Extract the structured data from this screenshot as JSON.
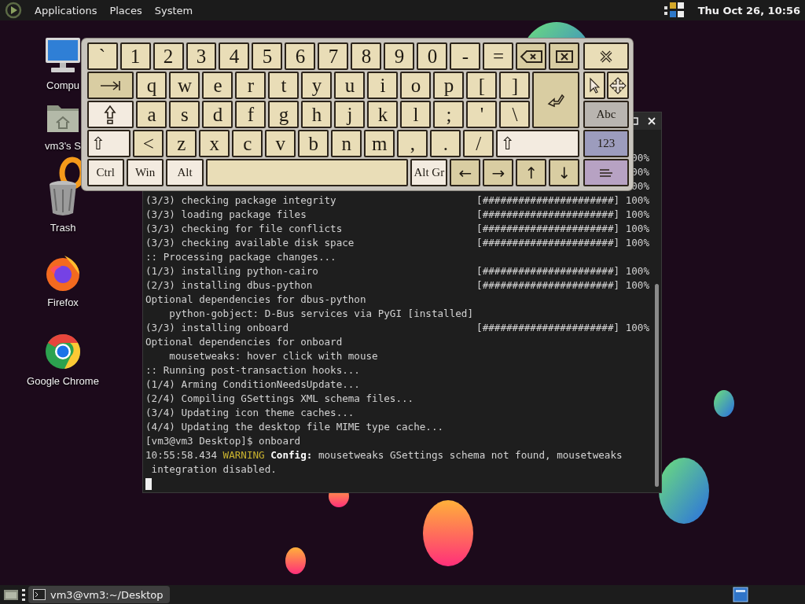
{
  "top_panel": {
    "menus": [
      "Applications",
      "Places",
      "System"
    ],
    "clock": "Thu Oct 26, 10:56"
  },
  "desktop_icons": [
    {
      "kind": "computer",
      "label": "Compu"
    },
    {
      "kind": "home-folder",
      "label": "vm3's S"
    },
    {
      "kind": "trash",
      "label": "Trash"
    },
    {
      "kind": "firefox",
      "label": "Firefox"
    },
    {
      "kind": "chrome",
      "label": "Google Chrome"
    }
  ],
  "terminal": {
    "lines": [
      {
        "pct": "00%"
      },
      {
        "pct": "00%"
      },
      {
        "pct": "00%"
      },
      {
        "text": "(3/3) checking package integrity",
        "bar": "[######################]",
        "pct": "100%"
      },
      {
        "text": "(3/3) loading package files",
        "bar": "[######################]",
        "pct": "100%"
      },
      {
        "text": "(3/3) checking for file conflicts",
        "bar": "[######################]",
        "pct": "100%"
      },
      {
        "text": "(3/3) checking available disk space",
        "bar": "[######################]",
        "pct": "100%"
      },
      {
        "text": ":: Processing package changes..."
      },
      {
        "text": "(1/3) installing python-cairo",
        "bar": "[######################]",
        "pct": "100%"
      },
      {
        "text": "(2/3) installing dbus-python",
        "bar": "[######################]",
        "pct": "100%"
      },
      {
        "text": "Optional dependencies for dbus-python"
      },
      {
        "text": "    python-gobject: D-Bus services via PyGI [installed]"
      },
      {
        "text": "(3/3) installing onboard",
        "bar": "[######################]",
        "pct": "100%"
      },
      {
        "text": "Optional dependencies for onboard"
      },
      {
        "text": "    mousetweaks: hover click with mouse"
      },
      {
        "text": ":: Running post-transaction hooks..."
      },
      {
        "text": "(1/4) Arming ConditionNeedsUpdate..."
      },
      {
        "text": "(2/4) Compiling GSettings XML schema files..."
      },
      {
        "text": "(3/4) Updating icon theme caches..."
      },
      {
        "text": "(4/4) Updating the desktop file MIME type cache..."
      },
      {
        "text": "[vm3@vm3 Desktop]$ onboard"
      },
      {
        "segments": [
          {
            "kind": "plain",
            "text": "10:55:58.434 "
          },
          {
            "kind": "warning",
            "text": "WARNING"
          },
          {
            "kind": "plain",
            "text": " **Config:** mousetweaks GSettings schema not found, mousetweaks"
          }
        ]
      },
      {
        "text": " integration disabled."
      }
    ]
  },
  "keyboard": {
    "rows": [
      [
        {
          "kind": "char",
          "label": "`"
        },
        {
          "kind": "char",
          "label": "1"
        },
        {
          "kind": "char",
          "label": "2"
        },
        {
          "kind": "char",
          "label": "3"
        },
        {
          "kind": "char",
          "label": "4"
        },
        {
          "kind": "char",
          "label": "5"
        },
        {
          "kind": "char",
          "label": "6"
        },
        {
          "kind": "char",
          "label": "7"
        },
        {
          "kind": "char",
          "label": "8"
        },
        {
          "kind": "char",
          "label": "9"
        },
        {
          "kind": "char",
          "label": "0"
        },
        {
          "kind": "char",
          "label": "-"
        },
        {
          "kind": "char",
          "label": "="
        },
        {
          "kind": "backspace"
        },
        {
          "kind": "delete"
        }
      ],
      [
        {
          "kind": "tab"
        },
        {
          "kind": "char",
          "label": "q"
        },
        {
          "kind": "char",
          "label": "w"
        },
        {
          "kind": "char",
          "label": "e"
        },
        {
          "kind": "char",
          "label": "r"
        },
        {
          "kind": "char",
          "label": "t"
        },
        {
          "kind": "char",
          "label": "y"
        },
        {
          "kind": "char",
          "label": "u"
        },
        {
          "kind": "char",
          "label": "i"
        },
        {
          "kind": "char",
          "label": "o"
        },
        {
          "kind": "char",
          "label": "p"
        },
        {
          "kind": "char",
          "label": "["
        },
        {
          "kind": "char",
          "label": "]"
        },
        {
          "kind": "enter"
        }
      ],
      [
        {
          "kind": "caps"
        },
        {
          "kind": "char",
          "label": "a"
        },
        {
          "kind": "char",
          "label": "s"
        },
        {
          "kind": "char",
          "label": "d"
        },
        {
          "kind": "char",
          "label": "f"
        },
        {
          "kind": "char",
          "label": "g"
        },
        {
          "kind": "char",
          "label": "h"
        },
        {
          "kind": "char",
          "label": "j"
        },
        {
          "kind": "char",
          "label": "k"
        },
        {
          "kind": "char",
          "label": "l"
        },
        {
          "kind": "char",
          "label": ";"
        },
        {
          "kind": "char",
          "label": "'"
        },
        {
          "kind": "char",
          "label": "\\"
        }
      ],
      [
        {
          "kind": "shift",
          "label": "⇧"
        },
        {
          "kind": "char",
          "label": "<"
        },
        {
          "kind": "char",
          "label": "z"
        },
        {
          "kind": "char",
          "label": "x"
        },
        {
          "kind": "char",
          "label": "c"
        },
        {
          "kind": "char",
          "label": "v"
        },
        {
          "kind": "char",
          "label": "b"
        },
        {
          "kind": "char",
          "label": "n"
        },
        {
          "kind": "char",
          "label": "m"
        },
        {
          "kind": "char",
          "label": ","
        },
        {
          "kind": "char",
          "label": "."
        },
        {
          "kind": "char",
          "label": "/"
        },
        {
          "kind": "shift_r",
          "label": "⇧"
        }
      ],
      [
        {
          "kind": "mod",
          "label": "Ctrl"
        },
        {
          "kind": "mod",
          "label": "Win"
        },
        {
          "kind": "mod",
          "label": "Alt"
        },
        {
          "kind": "space"
        },
        {
          "kind": "mod",
          "label": "Alt Gr"
        },
        {
          "kind": "arrow",
          "label": "←"
        },
        {
          "kind": "arrow",
          "label": "→"
        },
        {
          "kind": "arrow",
          "label": "↑"
        },
        {
          "kind": "arrow",
          "label": "↓"
        }
      ]
    ],
    "side_keys": [
      {
        "kind": "close"
      },
      {
        "kind": "pointer"
      },
      {
        "kind": "move"
      },
      {
        "kind": "layer",
        "label": "Abc",
        "color": "#b9b5b0"
      },
      {
        "kind": "layer",
        "label": "123",
        "color": "#9c9cbd"
      },
      {
        "kind": "menu",
        "color": "#b7a2c3"
      }
    ]
  },
  "bottom_panel": {
    "tasks": [
      {
        "label": "vm3@vm3:~/Desktop",
        "selected": true
      }
    ]
  }
}
